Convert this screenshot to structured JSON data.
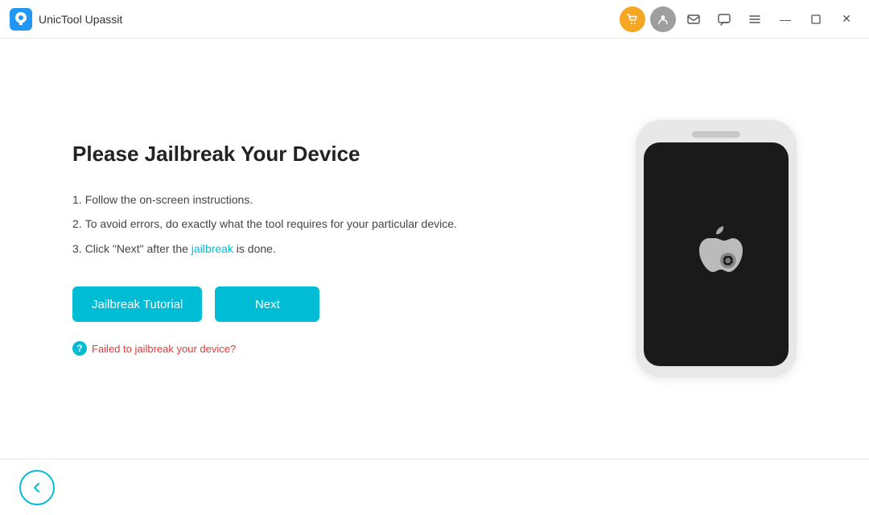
{
  "titlebar": {
    "app_name": "UnicTool Upassit"
  },
  "main": {
    "page_title": "Please Jailbreak Your Device",
    "instructions": [
      {
        "num": "1.",
        "text": "Follow the on-screen instructions."
      },
      {
        "num": "2.",
        "text": "To avoid errors, do exactly what the tool requires for your particular device."
      },
      {
        "num": "3.",
        "text": "Click \"Next\" after the ",
        "highlight": "jailbreak",
        "text_after": " is done."
      }
    ],
    "btn_jailbreak_label": "Jailbreak Tutorial",
    "btn_next_label": "Next",
    "failed_text": "Failed to jailbreak your device?"
  }
}
